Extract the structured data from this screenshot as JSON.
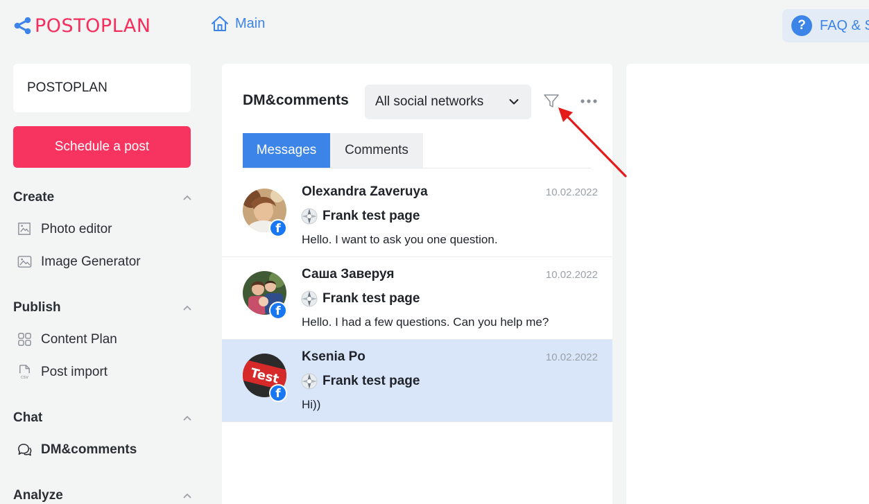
{
  "brand": {
    "logo_text": "POSTOPLAN",
    "brand_color": "#f52e5c"
  },
  "header": {
    "main_link": "Main",
    "faq_label": "FAQ & S"
  },
  "sidebar": {
    "org_name": "POSTOPLAN",
    "schedule_label": "Schedule a post",
    "sections": {
      "create": {
        "title": "Create",
        "items": [
          "Photo editor",
          "Image Generator"
        ]
      },
      "publish": {
        "title": "Publish",
        "items": [
          "Content Plan",
          "Post import"
        ]
      },
      "chat": {
        "title": "Chat",
        "items": [
          "DM&comments"
        ]
      },
      "analyze": {
        "title": "Analyze"
      }
    }
  },
  "inbox": {
    "title": "DM&comments",
    "network_filter": "All social networks",
    "tabs": [
      "Messages",
      "Comments"
    ],
    "active_tab": "Messages",
    "conversations": [
      {
        "name": "Olexandra Zaveruya",
        "date": "10.02.2022",
        "page": "Frank test page",
        "message": "Hello. I want to ask you one question.",
        "network": "facebook-icon",
        "selected": false
      },
      {
        "name": "Саша Заверуя",
        "date": "10.02.2022",
        "page": "Frank test page",
        "message": "Hello. I had a few questions. Can you help me?",
        "network": "facebook-icon",
        "selected": false
      },
      {
        "name": "Ksenia Po",
        "date": "10.02.2022",
        "page": "Frank test page",
        "message": "Hi))",
        "network": "facebook-icon",
        "selected": true
      }
    ]
  },
  "colors": {
    "accent": "#3d84e8",
    "primary_button": "#f7345f",
    "selected_row": "#d9e5f9",
    "annotation_arrow": "#e31b1b"
  }
}
